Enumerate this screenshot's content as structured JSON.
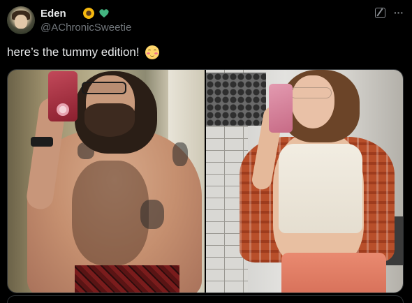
{
  "author": {
    "display_name": "Eden",
    "handle": "@AChronicSweetie",
    "badges": [
      "sunflower-icon",
      "green-heart-icon"
    ]
  },
  "tweet": {
    "text": "here’s the tummy edition!",
    "trailing_emoji": "blush-icon"
  },
  "header_actions": {
    "grok_icon": "grok-icon",
    "more_icon": "more-icon",
    "more_glyph": "···"
  },
  "media": {
    "count": 2,
    "images": [
      "mirror-selfie-left",
      "mirror-selfie-right"
    ]
  },
  "colors": {
    "background": "#000000",
    "primary_text": "#e7e9ea",
    "secondary_text": "#71767b",
    "border": "#2f3336",
    "heart": "#43b581",
    "sunflower": "#f6b90f"
  }
}
